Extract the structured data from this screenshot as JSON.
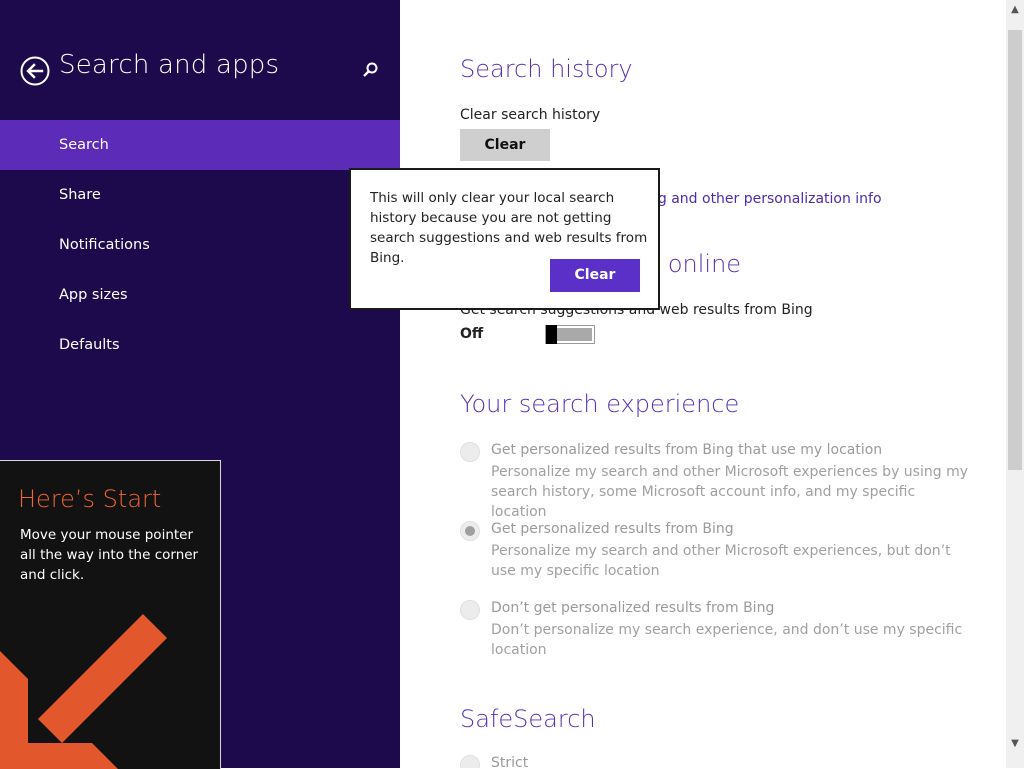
{
  "sidebar": {
    "title": "Search and apps",
    "back_icon": "back-arrow-icon",
    "search_icon": "search-icon",
    "items": [
      {
        "label": "Search",
        "active": true
      },
      {
        "label": "Share",
        "active": false
      },
      {
        "label": "Notifications",
        "active": false
      },
      {
        "label": "App sizes",
        "active": false
      },
      {
        "label": "Defaults",
        "active": false
      }
    ],
    "accent": "#5c2bb8",
    "background": "#1c0a4c"
  },
  "start_tip": {
    "title": "Here’s Start",
    "body": "Move your mouse pointer all the way into the corner and click.",
    "arrow_icon": "arrow-down-left-icon",
    "accent": "#f0643a"
  },
  "main": {
    "search_history": {
      "heading": "Search history",
      "clear_label": "Clear search history",
      "clear_button": "Clear",
      "link": "ng and other personalization info"
    },
    "search_online": {
      "heading_visible": "h online",
      "description_visible": "Get search suggestions and web results from Bing",
      "toggle_state": "Off",
      "toggle_on": false
    },
    "experience": {
      "heading": "Your search experience",
      "options": [
        {
          "title": "Get personalized results from Bing that use my location",
          "desc": "Personalize my search and other Microsoft experiences by using my search history, some Microsoft account info, and my specific location",
          "selected": false
        },
        {
          "title": "Get personalized results from Bing",
          "desc": "Personalize my search and other Microsoft experiences, but don’t use my specific location",
          "selected": true
        },
        {
          "title": "Don’t get personalized results from Bing",
          "desc": "Don’t personalize my search experience, and don’t use my specific location",
          "selected": false
        }
      ]
    },
    "safesearch": {
      "heading": "SafeSearch",
      "first_option": "Strict"
    }
  },
  "flyout": {
    "text": "This will only clear your local search history because you are not getting search suggestions and web results from Bing.",
    "button": "Clear"
  },
  "scrollbar": {
    "up_icon": "scroll-up-icon",
    "down_icon": "scroll-down-icon"
  }
}
